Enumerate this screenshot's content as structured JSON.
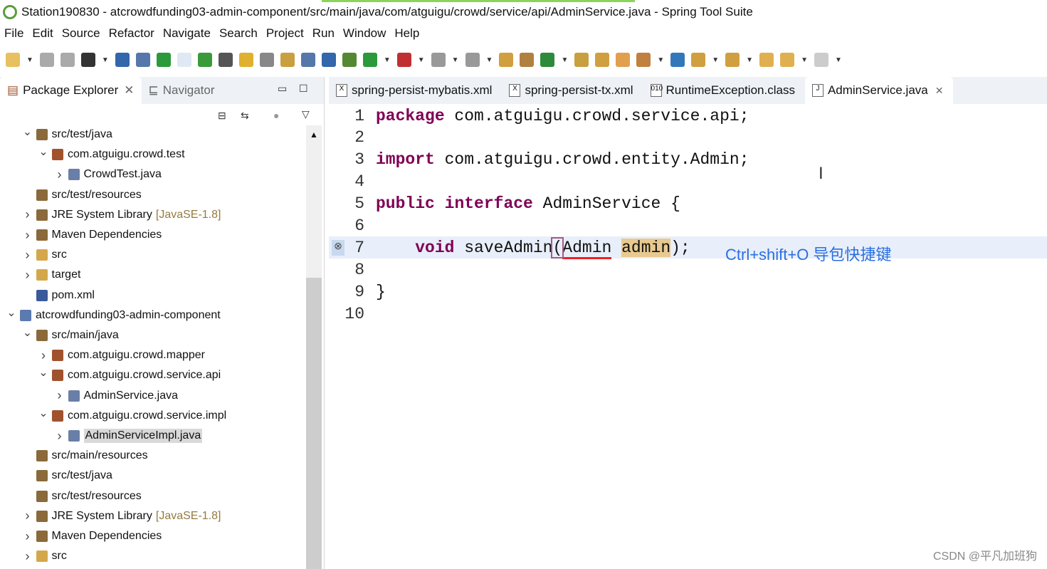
{
  "window": {
    "title": "Station190830 - atcrowdfunding03-admin-component/src/main/java/com/atguigu/crowd/service/api/AdminService.java - Spring Tool Suite"
  },
  "menu": [
    "File",
    "Edit",
    "Source",
    "Refactor",
    "Navigate",
    "Search",
    "Project",
    "Run",
    "Window",
    "Help"
  ],
  "left_panel": {
    "tabs": [
      "Package Explorer",
      "Navigator"
    ],
    "tree": [
      {
        "label": "src/test/java",
        "level": 1,
        "state": "expanded",
        "icon": "source-folder-icon"
      },
      {
        "label": "com.atguigu.crowd.test",
        "level": 2,
        "state": "expanded",
        "icon": "package-icon"
      },
      {
        "label": "CrowdTest.java",
        "level": 3,
        "state": "collapsed",
        "icon": "java-file-icon"
      },
      {
        "label": "src/test/resources",
        "level": 1,
        "state": "leaf",
        "icon": "source-folder-icon"
      },
      {
        "label": "JRE System Library",
        "decoration": "[JavaSE-1.8]",
        "level": 1,
        "state": "collapsed",
        "icon": "library-icon"
      },
      {
        "label": "Maven Dependencies",
        "level": 1,
        "state": "collapsed",
        "icon": "library-icon"
      },
      {
        "label": "src",
        "level": 1,
        "state": "collapsed",
        "icon": "folder-icon"
      },
      {
        "label": "target",
        "level": 1,
        "state": "collapsed",
        "icon": "folder-icon"
      },
      {
        "label": "pom.xml",
        "level": 1,
        "state": "leaf",
        "icon": "maven-file-icon"
      },
      {
        "label": "atcrowdfunding03-admin-component",
        "level": 0,
        "state": "expanded",
        "icon": "maven-project-icon"
      },
      {
        "label": "src/main/java",
        "level": 1,
        "state": "expanded",
        "icon": "source-folder-icon"
      },
      {
        "label": "com.atguigu.crowd.mapper",
        "level": 2,
        "state": "collapsed",
        "icon": "package-icon"
      },
      {
        "label": "com.atguigu.crowd.service.api",
        "level": 2,
        "state": "expanded",
        "icon": "package-icon"
      },
      {
        "label": "AdminService.java",
        "level": 3,
        "state": "collapsed",
        "icon": "interface-file-icon"
      },
      {
        "label": "com.atguigu.crowd.service.impl",
        "level": 2,
        "state": "expanded",
        "icon": "package-icon"
      },
      {
        "label": "AdminServiceImpl.java",
        "level": 3,
        "state": "collapsed",
        "icon": "java-file-icon",
        "selected": true
      },
      {
        "label": "src/main/resources",
        "level": 1,
        "state": "leaf",
        "icon": "source-folder-icon"
      },
      {
        "label": "src/test/java",
        "level": 1,
        "state": "leaf",
        "icon": "source-folder-icon"
      },
      {
        "label": "src/test/resources",
        "level": 1,
        "state": "leaf",
        "icon": "source-folder-icon"
      },
      {
        "label": "JRE System Library",
        "decoration": "[JavaSE-1.8]",
        "level": 1,
        "state": "collapsed",
        "icon": "library-icon"
      },
      {
        "label": "Maven Dependencies",
        "level": 1,
        "state": "collapsed",
        "icon": "library-icon"
      },
      {
        "label": "src",
        "level": 1,
        "state": "collapsed",
        "icon": "folder-icon"
      }
    ]
  },
  "editor": {
    "tabs": [
      {
        "label": "spring-persist-mybatis.xml",
        "icon": "xml-file-icon"
      },
      {
        "label": "spring-persist-tx.xml",
        "icon": "xml-file-icon"
      },
      {
        "label": "RuntimeException.class",
        "icon": "class-file-icon"
      },
      {
        "label": "AdminService.java",
        "icon": "java-file-icon",
        "active": true
      }
    ],
    "lines": [
      [
        {
          "t": "package",
          "k": "kw"
        },
        {
          "t": " com.atguigu.crowd.service.api;"
        }
      ],
      [],
      [
        {
          "t": "import",
          "k": "kw"
        },
        {
          "t": " com.atguigu.crowd.entity.Admin;"
        }
      ],
      [],
      [
        {
          "t": "public",
          "k": "kw"
        },
        {
          "t": " "
        },
        {
          "t": "interface",
          "k": "kw"
        },
        {
          "t": " AdminService {"
        }
      ],
      [],
      [
        {
          "t": "    "
        },
        {
          "t": "void",
          "k": "kw"
        },
        {
          "t": " saveAdmin"
        },
        {
          "t": "(",
          "k": "brk"
        },
        {
          "t": "Admin",
          "k": "err"
        },
        {
          "t": " "
        },
        {
          "t": "admin",
          "k": "occ"
        },
        {
          "t": ");"
        }
      ],
      [],
      [
        {
          "t": "}"
        }
      ],
      []
    ],
    "current_line": 7,
    "annotation": "Ctrl+shift+O 导包快捷键"
  },
  "watermark": "CSDN @平凡加班狗"
}
